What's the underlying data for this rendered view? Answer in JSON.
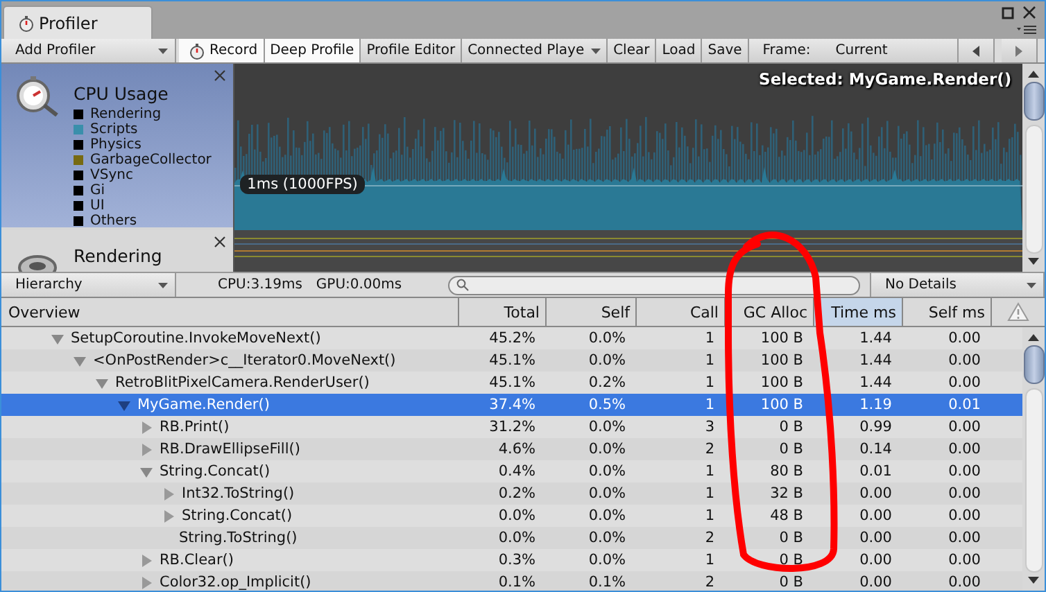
{
  "window": {
    "tab": "Profiler"
  },
  "toolbar": {
    "add_profiler": "Add Profiler",
    "buttons": [
      {
        "label": "Record",
        "kind": "record",
        "on": true
      },
      {
        "label": "Deep Profile",
        "kind": "toggle",
        "on": true
      },
      {
        "label": "Profile Editor",
        "kind": "toggle",
        "on": false
      },
      {
        "label": "Connected Playe",
        "kind": "dropdown"
      },
      {
        "label": "Clear",
        "kind": "button"
      },
      {
        "label": "Load",
        "kind": "button"
      },
      {
        "label": "Save",
        "kind": "button"
      }
    ],
    "frame_label": "Frame:",
    "frame_value": "Current"
  },
  "modules": [
    {
      "title": "CPU Usage",
      "kind": "cpu",
      "legend": [
        {
          "label": "Rendering",
          "color": "#000000"
        },
        {
          "label": "Scripts",
          "color": "#3a8fab"
        },
        {
          "label": "Physics",
          "color": "#000000"
        },
        {
          "label": "GarbageCollector",
          "color": "#776a12"
        },
        {
          "label": "VSync",
          "color": "#000000"
        },
        {
          "label": "Gi",
          "color": "#000000"
        },
        {
          "label": "UI",
          "color": "#000000"
        },
        {
          "label": "Others",
          "color": "#000000"
        }
      ]
    },
    {
      "title": "Rendering",
      "kind": "rendering"
    }
  ],
  "chart": {
    "selected_label": "Selected: MyGame.Render()",
    "marker": "1ms (1000FPS)"
  },
  "hierarchy_bar": {
    "view": "Hierarchy",
    "cpu": "CPU:3.19ms",
    "gpu": "GPU:0.00ms",
    "details": "No Details"
  },
  "table": {
    "columns": [
      {
        "label": "Overview",
        "sorted": false
      },
      {
        "label": "Total",
        "sorted": false
      },
      {
        "label": "Self",
        "sorted": false
      },
      {
        "label": "Call",
        "sorted": false
      },
      {
        "label": "GC Alloc",
        "sorted": false
      },
      {
        "label": "Time ms",
        "sorted": true
      },
      {
        "label": "Self ms",
        "sorted": false
      }
    ],
    "rows": [
      {
        "name": "SetupCoroutine.InvokeMoveNext()",
        "total": "45.2%",
        "self": "0.0%",
        "calls": "1",
        "gc_alloc": "100 B",
        "time_ms": "1.44",
        "self_ms": "0.00",
        "selected": false,
        "expanded": true,
        "children": [
          {
            "name": "<OnPostRender>c__Iterator0.MoveNext()",
            "total": "45.1%",
            "self": "0.0%",
            "calls": "1",
            "gc_alloc": "100 B",
            "time_ms": "1.44",
            "self_ms": "0.00",
            "selected": false,
            "expanded": true,
            "children": [
              {
                "name": "RetroBlitPixelCamera.RenderUser()",
                "total": "45.1%",
                "self": "0.2%",
                "calls": "1",
                "gc_alloc": "100 B",
                "time_ms": "1.44",
                "self_ms": "0.00",
                "selected": false,
                "expanded": true,
                "children": [
                  {
                    "name": "MyGame.Render()",
                    "total": "37.4%",
                    "self": "0.5%",
                    "calls": "1",
                    "gc_alloc": "100 B",
                    "time_ms": "1.19",
                    "self_ms": "0.01",
                    "selected": true,
                    "expanded": true,
                    "children": [
                      {
                        "name": "RB.Print()",
                        "total": "31.2%",
                        "self": "0.0%",
                        "calls": "3",
                        "gc_alloc": "0 B",
                        "time_ms": "0.99",
                        "self_ms": "0.00",
                        "selected": false,
                        "expanded": false
                      },
                      {
                        "name": "RB.DrawEllipseFill()",
                        "total": "4.6%",
                        "self": "0.0%",
                        "calls": "2",
                        "gc_alloc": "0 B",
                        "time_ms": "0.14",
                        "self_ms": "0.00",
                        "selected": false,
                        "expanded": false
                      },
                      {
                        "name": "String.Concat()",
                        "total": "0.4%",
                        "self": "0.0%",
                        "calls": "1",
                        "gc_alloc": "80 B",
                        "time_ms": "0.01",
                        "self_ms": "0.00",
                        "selected": false,
                        "expanded": true,
                        "children": [
                          {
                            "name": "Int32.ToString()",
                            "total": "0.2%",
                            "self": "0.0%",
                            "calls": "1",
                            "gc_alloc": "32 B",
                            "time_ms": "0.00",
                            "self_ms": "0.00",
                            "selected": false,
                            "expanded": false
                          },
                          {
                            "name": "String.Concat()",
                            "total": "0.0%",
                            "self": "0.0%",
                            "calls": "1",
                            "gc_alloc": "48 B",
                            "time_ms": "0.00",
                            "self_ms": "0.00",
                            "selected": false,
                            "expanded": false
                          },
                          {
                            "name": "String.ToString()",
                            "total": "0.0%",
                            "self": "0.0%",
                            "calls": "2",
                            "gc_alloc": "0 B",
                            "time_ms": "0.00",
                            "self_ms": "0.00",
                            "selected": false
                          }
                        ]
                      },
                      {
                        "name": "RB.Clear()",
                        "total": "0.3%",
                        "self": "0.0%",
                        "calls": "1",
                        "gc_alloc": "0 B",
                        "time_ms": "0.00",
                        "self_ms": "0.00",
                        "selected": false,
                        "expanded": false
                      },
                      {
                        "name": "Color32.op_Implicit()",
                        "total": "0.1%",
                        "self": "0.1%",
                        "calls": "2",
                        "gc_alloc": "0 B",
                        "time_ms": "0.00",
                        "self_ms": "0.00",
                        "selected": false,
                        "expanded": false
                      }
                    ]
                  }
                ]
              }
            ]
          }
        ]
      }
    ]
  }
}
